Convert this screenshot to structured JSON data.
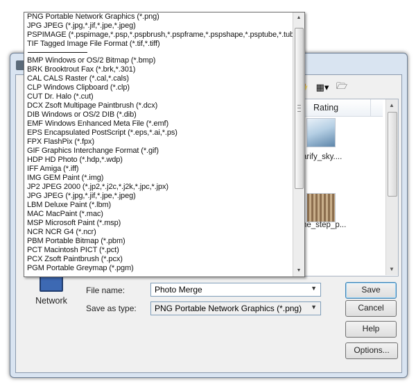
{
  "file_list": {
    "column_header": "Rating",
    "files": [
      {
        "label": "arify_sky...."
      },
      {
        "label": "ne_step_p..."
      }
    ]
  },
  "places": {
    "network_label": "Network"
  },
  "form": {
    "file_name_label": "File name:",
    "file_name_value": "Photo Merge",
    "save_type_label": "Save as type:",
    "save_type_value": "PNG Portable Network Graphics (*.png)"
  },
  "buttons": {
    "save": "Save",
    "cancel": "Cancel",
    "help": "Help",
    "options": "Options..."
  },
  "format_dropdown": {
    "recent": [
      "PNG Portable Network Graphics (*.png)",
      "JPG JPEG  (*.jpg,*.jif,*.jpe,*.jpeg)",
      "PSPIMAGE (*.pspimage,*.psp,*.pspbrush,*.pspframe,*.pspshape,*.psptube,*.tub)",
      "TIF Tagged Image File Format (*.tif,*.tiff)"
    ],
    "all": [
      "BMP Windows or OS/2 Bitmap (*.bmp)",
      "BRK Brooktrout Fax (*.brk,*.301)",
      "CAL CALS Raster (*.cal,*.cals)",
      "CLP Windows Clipboard (*.clp)",
      "CUT Dr. Halo (*.cut)",
      "DCX Zsoft Multipage Paintbrush (*.dcx)",
      "DIB Windows or OS/2 DIB (*.dib)",
      "EMF Windows Enhanced Meta File (*.emf)",
      "EPS Encapsulated PostScript (*.eps,*.ai,*.ps)",
      "FPX FlashPix (*.fpx)",
      "GIF Graphics Interchange Format (*.gif)",
      "HDP HD Photo (*.hdp,*.wdp)",
      "IFF Amiga (*.iff)",
      "IMG GEM Paint (*.img)",
      "JP2 JPEG 2000 (*.jp2,*.j2c,*.j2k,*.jpc,*.jpx)",
      "JPG JPEG (*.jpg,*.jif,*.jpe,*.jpeg)",
      "LBM Deluxe Paint (*.lbm)",
      "MAC MacPaint (*.mac)",
      "MSP Microsoft Paint (*.msp)",
      "NCR NCR G4 (*.ncr)",
      "PBM Portable Bitmap (*.pbm)",
      "PCT Macintosh PICT (*.pct)",
      "PCX Zsoft Paintbrush (*.pcx)",
      "PGM Portable Greymap (*.pgm)"
    ]
  }
}
